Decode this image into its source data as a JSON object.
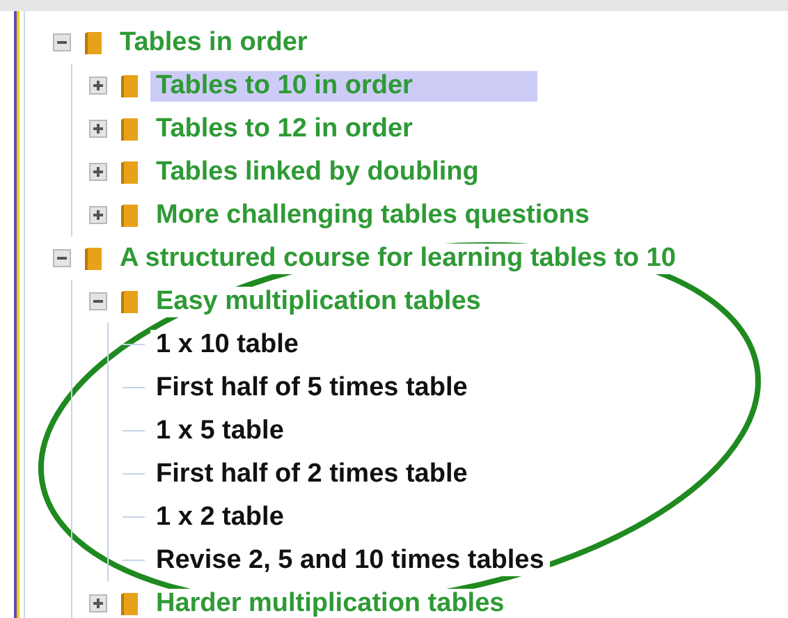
{
  "tree": [
    {
      "kind": "folder",
      "label": "Tables in order",
      "expanded": true,
      "selected": false,
      "children": [
        {
          "kind": "folder",
          "label": "Tables to 10 in order",
          "expanded": false,
          "selected": true
        },
        {
          "kind": "folder",
          "label": "Tables to 12 in order",
          "expanded": false,
          "selected": false
        },
        {
          "kind": "folder",
          "label": "Tables linked by doubling",
          "expanded": false,
          "selected": false
        },
        {
          "kind": "folder",
          "label": "More challenging tables questions",
          "expanded": false,
          "selected": false
        }
      ]
    },
    {
      "kind": "folder",
      "label": "A structured course for learning tables to 10",
      "expanded": true,
      "selected": false,
      "children": [
        {
          "kind": "folder",
          "label": "Easy multiplication tables",
          "expanded": true,
          "selected": false,
          "children": [
            {
              "kind": "leaf",
              "label": "1 x 10 table",
              "selected": false
            },
            {
              "kind": "leaf",
              "label": "First half of 5 times table",
              "selected": false
            },
            {
              "kind": "leaf",
              "label": "1 x 5 table",
              "selected": false
            },
            {
              "kind": "leaf",
              "label": "First half of 2 times table",
              "selected": false
            },
            {
              "kind": "leaf",
              "label": "1 x 2 table",
              "selected": false
            },
            {
              "kind": "leaf",
              "label": "Revise 2, 5 and 10 times tables",
              "selected": false
            }
          ]
        },
        {
          "kind": "folder",
          "label": "Harder multiplication tables",
          "expanded": false,
          "selected": false
        }
      ]
    }
  ]
}
